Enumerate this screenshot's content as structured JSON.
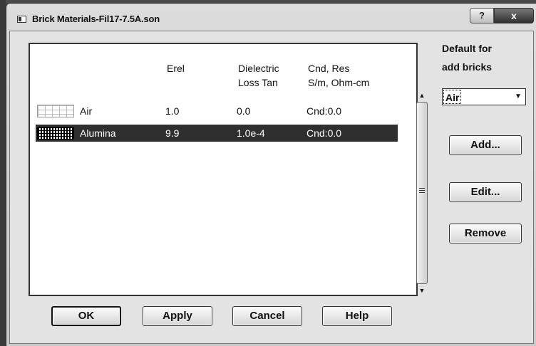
{
  "window": {
    "title": "Brick Materials-Fil17-7.5A.son",
    "help_label": "?",
    "close_label": "x"
  },
  "table": {
    "headers": {
      "erel": "Erel",
      "dielectric_line1": "Dielectric",
      "dielectric_line2": "Loss Tan",
      "cnd_line1": "Cnd, Res",
      "cnd_line2": "S/m, Ohm-cm"
    },
    "rows": [
      {
        "name": "Air",
        "erel": "1.0",
        "loss_tan": "0.0",
        "cnd": "Cnd:0.0",
        "selected": false
      },
      {
        "name": "Alumina",
        "erel": "9.9",
        "loss_tan": "1.0e-4",
        "cnd": "Cnd:0.0",
        "selected": true
      }
    ]
  },
  "scrollbar": {
    "up_icon": "scroll-up-arrow",
    "down_icon": "scroll-down-arrow"
  },
  "default_panel": {
    "label_line1": "Default for",
    "label_line2": "add bricks",
    "selected": "Air"
  },
  "side_buttons": {
    "add": "Add...",
    "edit": "Edit...",
    "remove": "Remove"
  },
  "bottom_buttons": {
    "ok": "OK",
    "apply": "Apply",
    "cancel": "Cancel",
    "help": "Help"
  }
}
